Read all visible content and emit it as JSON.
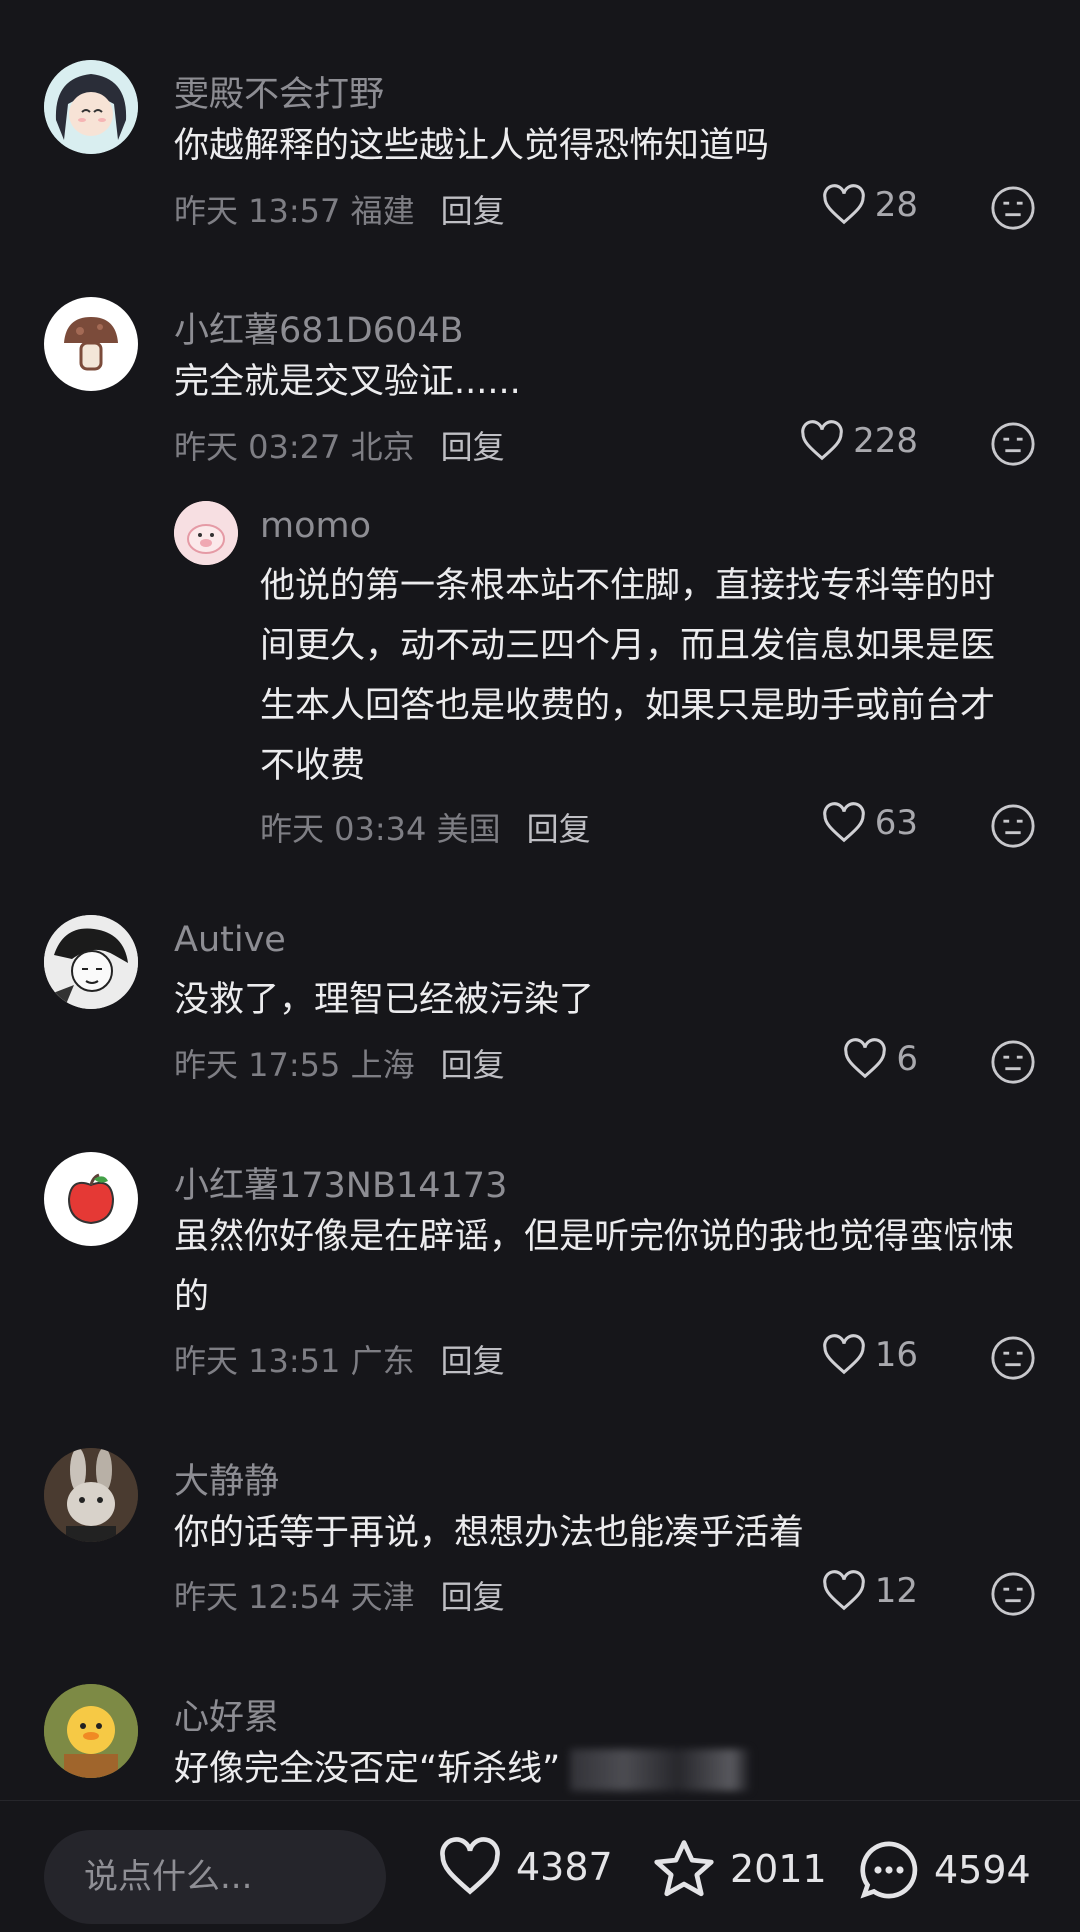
{
  "comments": [
    {
      "user": "雯殿不会打野",
      "text": "你越解释的这些越让人觉得恐怖知道吗",
      "time": "昨天 13:57 福建",
      "reply": "回复",
      "likes": "28",
      "avatar": "girl-avatar"
    },
    {
      "user": "小红薯681D604B",
      "text": "完全就是交叉验证......",
      "time": "昨天 03:27 北京",
      "reply": "回复",
      "likes": "228",
      "avatar": "mushroom-avatar"
    },
    {
      "user": "momo",
      "text": "他说的第一条根本站不住脚，直接找专科等的时间更久，动不动三四个月，而且发信息如果是医生本人回答也是收费的，如果只是助手或前台才不收费",
      "time": "昨天 03:34 美国",
      "reply": "回复",
      "likes": "63",
      "avatar": "pig-avatar"
    },
    {
      "user": "Autive",
      "text": "没救了，理智已经被污染了",
      "time": "昨天 17:55 上海",
      "reply": "回复",
      "likes": "6",
      "avatar": "manga-avatar"
    },
    {
      "user": "小红薯173NB14173",
      "text": "虽然你好像是在辟谣，但是听完你说的我也觉得蛮惊悚的",
      "time": "昨天 13:51 广东",
      "reply": "回复",
      "likes": "16",
      "avatar": "apple-avatar"
    },
    {
      "user": "大静静",
      "text": "你的话等于再说，想想办法也能凑乎活着",
      "time": "昨天 12:54 天津",
      "reply": "回复",
      "likes": "12",
      "avatar": "rabbit-avatar"
    },
    {
      "user": "心好累",
      "text": "好像完全没否定“斩杀线”",
      "avatar": "duck-avatar"
    }
  ],
  "bottom_bar": {
    "placeholder": "说点什么...",
    "likes": "4387",
    "stars": "2011",
    "comments": "4594"
  },
  "colors": {
    "background": "#16161a",
    "muted": "#8d8d93",
    "text": "#ececee"
  }
}
